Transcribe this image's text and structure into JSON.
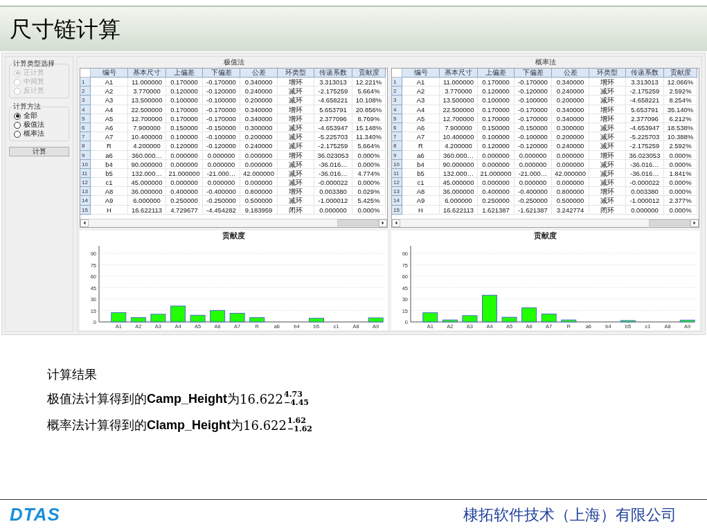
{
  "title": "尺寸链计算",
  "calc_type": {
    "label": "计算类型选择",
    "options": [
      {
        "label": "正计算",
        "selected": true,
        "disabled": true
      },
      {
        "label": "中间算",
        "selected": false,
        "disabled": true
      },
      {
        "label": "反计算",
        "selected": false,
        "disabled": true
      }
    ]
  },
  "calc_method": {
    "label": "计算方法",
    "options": [
      {
        "label": "全部",
        "selected": true,
        "disabled": false
      },
      {
        "label": "极值法",
        "selected": false,
        "disabled": false
      },
      {
        "label": "概率法",
        "selected": false,
        "disabled": false
      }
    ]
  },
  "calc_button": "计算",
  "panels": [
    {
      "title": "极值法",
      "columns": [
        "编号",
        "基本尺寸",
        "上偏差",
        "下偏差",
        "公差",
        "环类型",
        "传递系数",
        "贡献度"
      ],
      "rows": [
        {
          "index": "1",
          "cells": [
            "A1",
            "11.000000",
            "0.170000",
            "-0.170000",
            "0.340000",
            "增环",
            "3.313013",
            "12.221%"
          ]
        },
        {
          "index": "2",
          "cells": [
            "A2",
            "3.770000",
            "0.120000",
            "-0.120000",
            "0.240000",
            "减环",
            "-2.175259",
            "5.664%"
          ]
        },
        {
          "index": "3",
          "cells": [
            "A3",
            "13.500000",
            "0.100000",
            "-0.100000",
            "0.200000",
            "减环",
            "-4.658221",
            "10.108%"
          ]
        },
        {
          "index": "4",
          "cells": [
            "A4",
            "22.500000",
            "0.170000",
            "-0.170000",
            "0.340000",
            "增环",
            "5.653791",
            "20.856%"
          ]
        },
        {
          "index": "5",
          "cells": [
            "A5",
            "12.700000",
            "0.170000",
            "-0.170000",
            "0.340000",
            "增环",
            "2.377096",
            "8.769%"
          ]
        },
        {
          "index": "6",
          "cells": [
            "A6",
            "7.900000",
            "0.150000",
            "-0.150000",
            "0.300000",
            "减环",
            "-4.653947",
            "15.148%"
          ]
        },
        {
          "index": "7",
          "cells": [
            "A7",
            "10.400000",
            "0.100000",
            "-0.100000",
            "0.200000",
            "减环",
            "-5.225703",
            "11.340%"
          ]
        },
        {
          "index": "8",
          "cells": [
            "R",
            "4.200000",
            "0.120000",
            "-0.120000",
            "0.240000",
            "减环",
            "-2.175259",
            "5.664%"
          ]
        },
        {
          "index": "9",
          "cells": [
            "a6",
            "360.000…",
            "0.000000",
            "0.000000",
            "0.000000",
            "增环",
            "36.023053",
            "0.000%"
          ]
        },
        {
          "index": "10",
          "cells": [
            "b4",
            "90.000000",
            "0.000000",
            "0.000000",
            "0.000000",
            "减环",
            "-36.016…",
            "0.000%"
          ]
        },
        {
          "index": "11",
          "cells": [
            "b5",
            "132.000…",
            "21.000000",
            "-21.000…",
            "42.000000",
            "减环",
            "-36.016…",
            "4.774%"
          ]
        },
        {
          "index": "12",
          "cells": [
            "c1",
            "45.000000",
            "0.000000",
            "0.000000",
            "0.000000",
            "减环",
            "-0.000022",
            "0.000%"
          ]
        },
        {
          "index": "13",
          "cells": [
            "A8",
            "36.000000",
            "0.400000",
            "-0.400000",
            "0.800000",
            "增环",
            "0.003380",
            "0.029%"
          ]
        },
        {
          "index": "14",
          "cells": [
            "A9",
            "6.000000",
            "0.250000",
            "-0.250000",
            "0.500000",
            "减环",
            "-1.000012",
            "5.425%"
          ]
        },
        {
          "index": "15",
          "cells": [
            "H",
            "16.622113",
            "4.729677",
            "-4.454282",
            "9.183959",
            "闭环",
            "0.000000",
            "0.000%"
          ]
        }
      ],
      "chart_data": {
        "type": "bar",
        "title": "贡献度",
        "categories": [
          "A1",
          "A2",
          "A3",
          "A4",
          "A5",
          "A6",
          "A7",
          "R",
          "a6",
          "b4",
          "b5",
          "c1",
          "A8",
          "A9"
        ],
        "values": [
          12.2,
          5.7,
          10.1,
          20.9,
          8.8,
          15.1,
          11.3,
          5.7,
          0,
          0,
          4.8,
          0,
          0,
          5.4
        ],
        "grid": true,
        "ylim": [
          0,
          100
        ],
        "yticks": [
          0,
          15,
          30,
          45,
          60,
          75,
          90
        ]
      }
    },
    {
      "title": "概率法",
      "columns": [
        "编号",
        "基本尺寸",
        "上偏差",
        "下偏差",
        "公差",
        "环类型",
        "传递系数",
        "贡献度"
      ],
      "rows": [
        {
          "index": "1",
          "cells": [
            "A1",
            "11.000000",
            "0.170000",
            "-0.170000",
            "0.340000",
            "增环",
            "3.313013",
            "12.066%"
          ]
        },
        {
          "index": "2",
          "cells": [
            "A2",
            "3.770000",
            "0.120000",
            "-0.120000",
            "0.240000",
            "减环",
            "-2.175259",
            "2.592%"
          ]
        },
        {
          "index": "3",
          "cells": [
            "A3",
            "13.500000",
            "0.100000",
            "-0.100000",
            "0.200000",
            "减环",
            "-4.658221",
            "8.254%"
          ]
        },
        {
          "index": "4",
          "cells": [
            "A4",
            "22.500000",
            "0.170000",
            "-0.170000",
            "0.340000",
            "增环",
            "5.653791",
            "35.140%"
          ]
        },
        {
          "index": "5",
          "cells": [
            "A5",
            "12.700000",
            "0.170000",
            "-0.170000",
            "0.340000",
            "增环",
            "2.377096",
            "6.212%"
          ]
        },
        {
          "index": "6",
          "cells": [
            "A6",
            "7.900000",
            "0.150000",
            "-0.150000",
            "0.300000",
            "减环",
            "-4.653947",
            "18.538%"
          ]
        },
        {
          "index": "7",
          "cells": [
            "A7",
            "10.400000",
            "0.100000",
            "-0.100000",
            "0.200000",
            "减环",
            "-5.225703",
            "10.388%"
          ]
        },
        {
          "index": "8",
          "cells": [
            "R",
            "4.200000",
            "0.120000",
            "-0.120000",
            "0.240000",
            "减环",
            "-2.175259",
            "2.592%"
          ]
        },
        {
          "index": "9",
          "cells": [
            "a6",
            "360.000…",
            "0.000000",
            "0.000000",
            "0.000000",
            "增环",
            "36.023053",
            "0.000%"
          ]
        },
        {
          "index": "10",
          "cells": [
            "b4",
            "90.000000",
            "0.000000",
            "0.000000",
            "0.000000",
            "减环",
            "-36.016…",
            "0.000%"
          ]
        },
        {
          "index": "11",
          "cells": [
            "b5",
            "132.000…",
            "21.000000",
            "-21.000…",
            "42.000000",
            "减环",
            "-36.016…",
            "1.841%"
          ]
        },
        {
          "index": "12",
          "cells": [
            "c1",
            "45.000000",
            "0.000000",
            "0.000000",
            "0.000000",
            "减环",
            "-0.000022",
            "0.000%"
          ]
        },
        {
          "index": "13",
          "cells": [
            "A8",
            "36.000000",
            "0.400000",
            "-0.400000",
            "0.800000",
            "增环",
            "0.003380",
            "0.000%"
          ]
        },
        {
          "index": "14",
          "cells": [
            "A9",
            "6.000000",
            "0.250000",
            "-0.250000",
            "0.500000",
            "减环",
            "-1.000012",
            "2.377%"
          ]
        },
        {
          "index": "15",
          "cells": [
            "H",
            "16.622113",
            "1.621387",
            "-1.621387",
            "3.242774",
            "闭环",
            "0.000000",
            "0.000%"
          ]
        }
      ],
      "chart_data": {
        "type": "bar",
        "title": "贡献度",
        "categories": [
          "A1",
          "A2",
          "A3",
          "A4",
          "A5",
          "A6",
          "A7",
          "R",
          "a6",
          "b4",
          "b5",
          "c1",
          "A8",
          "A9"
        ],
        "values": [
          12.1,
          2.6,
          8.3,
          35.1,
          6.2,
          18.5,
          10.4,
          2.6,
          0,
          0,
          1.8,
          0,
          0,
          2.4
        ],
        "grid": true,
        "ylim": [
          0,
          100
        ],
        "yticks": [
          0,
          15,
          30,
          45,
          60,
          75,
          90
        ]
      }
    }
  ],
  "results": {
    "heading": "计算结果",
    "lines": [
      {
        "text": "极值法计算得到的**Camp_Height**为",
        "nominal": "16.622",
        "upper": "4.73",
        "lower": "−4.45"
      },
      {
        "text": "概率法计算得到的**Clamp_Height**为",
        "nominal": "16.622",
        "upper": "1.62",
        "lower": "−1.62"
      }
    ]
  },
  "footer": {
    "logo": "DTAS",
    "company": "棣拓软件技术（上海）有限公司"
  }
}
